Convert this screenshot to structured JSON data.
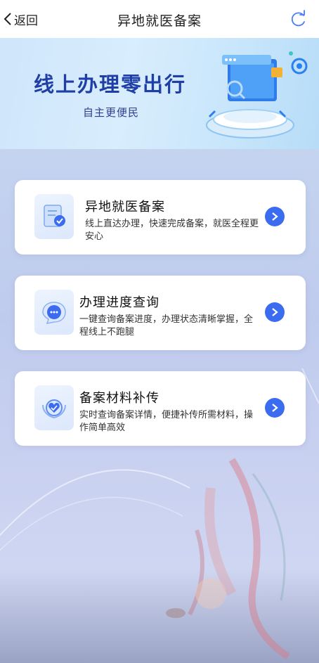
{
  "nav": {
    "back_label": "返回",
    "title": "异地就医备案"
  },
  "banner": {
    "title": "线上办理零出行",
    "subtitle": "自主更便民"
  },
  "cards": [
    {
      "title": "异地就医备案",
      "desc": "线上直达办理，快速完成备案，就医全程更安心",
      "icon": "document-check-icon"
    },
    {
      "title": "办理进度查询",
      "desc": "一键查询备案进度，办理状态清晰掌握，全程线上不跑腿",
      "icon": "chat-bubble-icon"
    },
    {
      "title": "备案材料补传",
      "desc": "实时查询备案详情，便捷补传所需材料，操作简单高效",
      "icon": "heart-shield-icon"
    }
  ],
  "colors": {
    "accent": "#3b6cf0",
    "banner_title": "#1f3fa6"
  }
}
